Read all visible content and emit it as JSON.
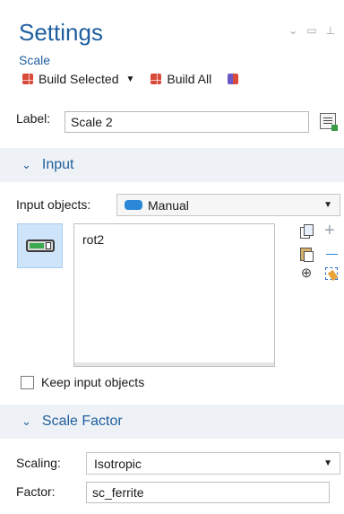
{
  "header": {
    "title": "Settings",
    "subtitle": "Scale"
  },
  "toolbar": {
    "build_selected_label": "Build Selected",
    "build_all_label": "Build All"
  },
  "label_row": {
    "label": "Label:",
    "value": "Scale 2"
  },
  "input_section": {
    "title": "Input",
    "input_objects_label": "Input objects:",
    "input_objects_value": "Manual",
    "list_items": [
      "rot2"
    ],
    "keep_input_label": "Keep input objects",
    "keep_input_checked": false
  },
  "scale_factor_section": {
    "title": "Scale Factor",
    "scaling_label": "Scaling:",
    "scaling_value": "Isotropic",
    "factor_label": "Factor:",
    "factor_value": "sc_ferrite"
  },
  "icons": {
    "build_selected": "build-selected-icon",
    "build_all": "build-all-icon",
    "build_extra": "build-preview-icon",
    "label_edit": "label-edit-icon",
    "manual": "manual-selection-icon",
    "activate_selection": "selection-toggle-icon",
    "copy": "copy-icon",
    "paste": "paste-icon",
    "zoom_to_selection": "zoom-selection-icon",
    "add": "add-icon",
    "remove": "remove-icon",
    "clear_selection": "clear-selection-icon"
  },
  "colors": {
    "accent": "#1f5f9f",
    "section_bg": "#eef1f5",
    "active_tile": "#cde4fa"
  }
}
